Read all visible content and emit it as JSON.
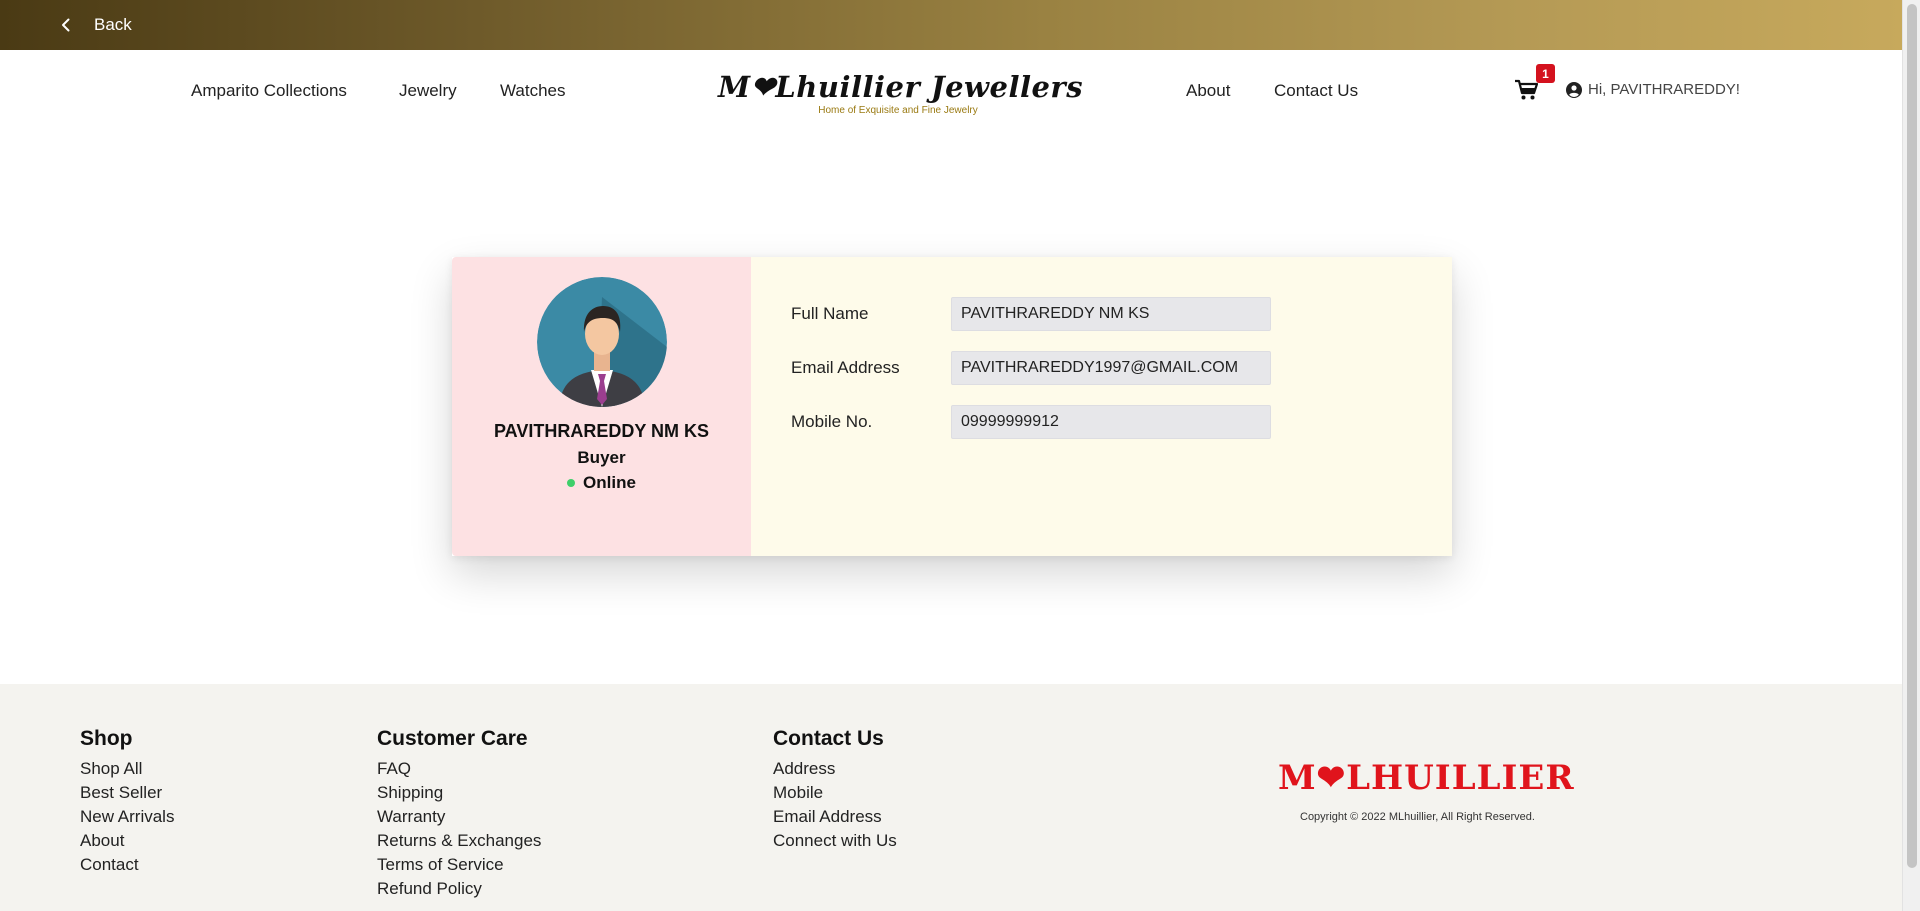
{
  "topbar": {
    "back_label": "Back"
  },
  "nav": {
    "left_items": [
      "Amparito Collections",
      "Jewelry",
      "Watches"
    ],
    "right_items": [
      "About",
      "Contact Us"
    ],
    "logo_title": "M❤Lhuillier Jewellers",
    "logo_tagline": "Home of Exquisite and Fine Jewelry",
    "cart_count": "1",
    "greeting": "Hi, PAVITHRAREDDY!"
  },
  "profile": {
    "name": "PAVITHRAREDDY NM KS",
    "role": "Buyer",
    "status": "Online",
    "status_color": "#3ecf6a",
    "fields": [
      {
        "label": "Full Name",
        "value": "PAVITHRAREDDY NM KS"
      },
      {
        "label": "Email Address",
        "value": "PAVITHRAREDDY1997@GMAIL.COM"
      },
      {
        "label": "Mobile No.",
        "value": "09999999912"
      }
    ]
  },
  "footer": {
    "shop": {
      "title": "Shop",
      "links": [
        "Shop All",
        "Best Seller",
        "New Arrivals",
        "About",
        "Contact"
      ]
    },
    "care": {
      "title": "Customer Care",
      "links": [
        "FAQ",
        "Shipping",
        "Warranty",
        "Returns & Exchanges",
        "Terms of Service",
        "Refund Policy"
      ]
    },
    "contact": {
      "title": "Contact Us",
      "links": [
        "Address",
        "Mobile",
        "Email Address",
        "Connect with Us"
      ]
    },
    "brand": "M❤LHUILLIER",
    "copyright": "Copyright © 2022 MLhuillier, All Right Reserved."
  },
  "colors": {
    "brand_red": "#e0141c",
    "gold_dark": "#4a3a14",
    "gold_light": "#c7a95c"
  }
}
